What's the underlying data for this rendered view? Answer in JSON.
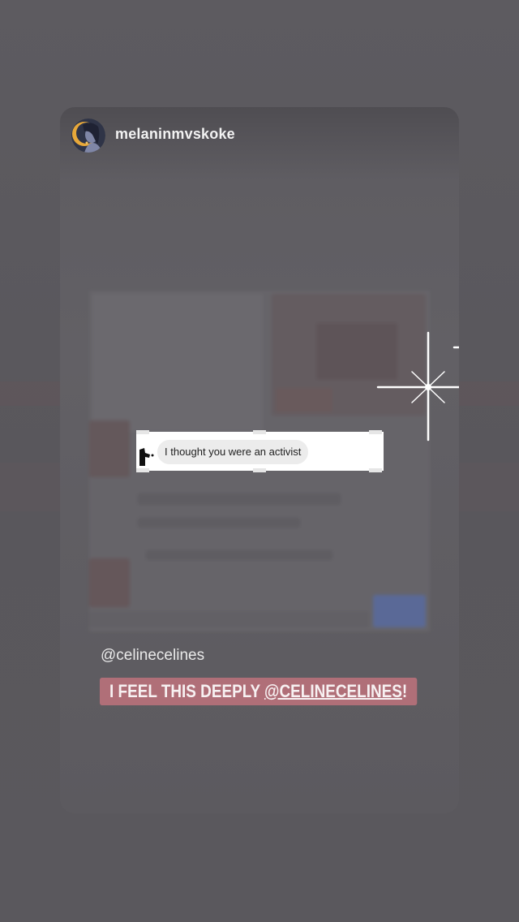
{
  "story": {
    "username": "melaninmvskoke",
    "message_text": "I thought you were an activist",
    "mention": "@celinecelines",
    "caption": {
      "prefix": "I FEEL THIS DEEPLY ",
      "mention": "@CELINECELINES",
      "suffix": "!"
    },
    "icons": {
      "avatar": "profile-avatar",
      "sparkles": "sparkle-sticker"
    },
    "colors": {
      "background": "#5c5a5f",
      "caption_bg": "#b06f78",
      "caption_text": "#f7f1f2",
      "sticker_bg": "#ffffff",
      "bubble_bg": "#ececec"
    }
  }
}
